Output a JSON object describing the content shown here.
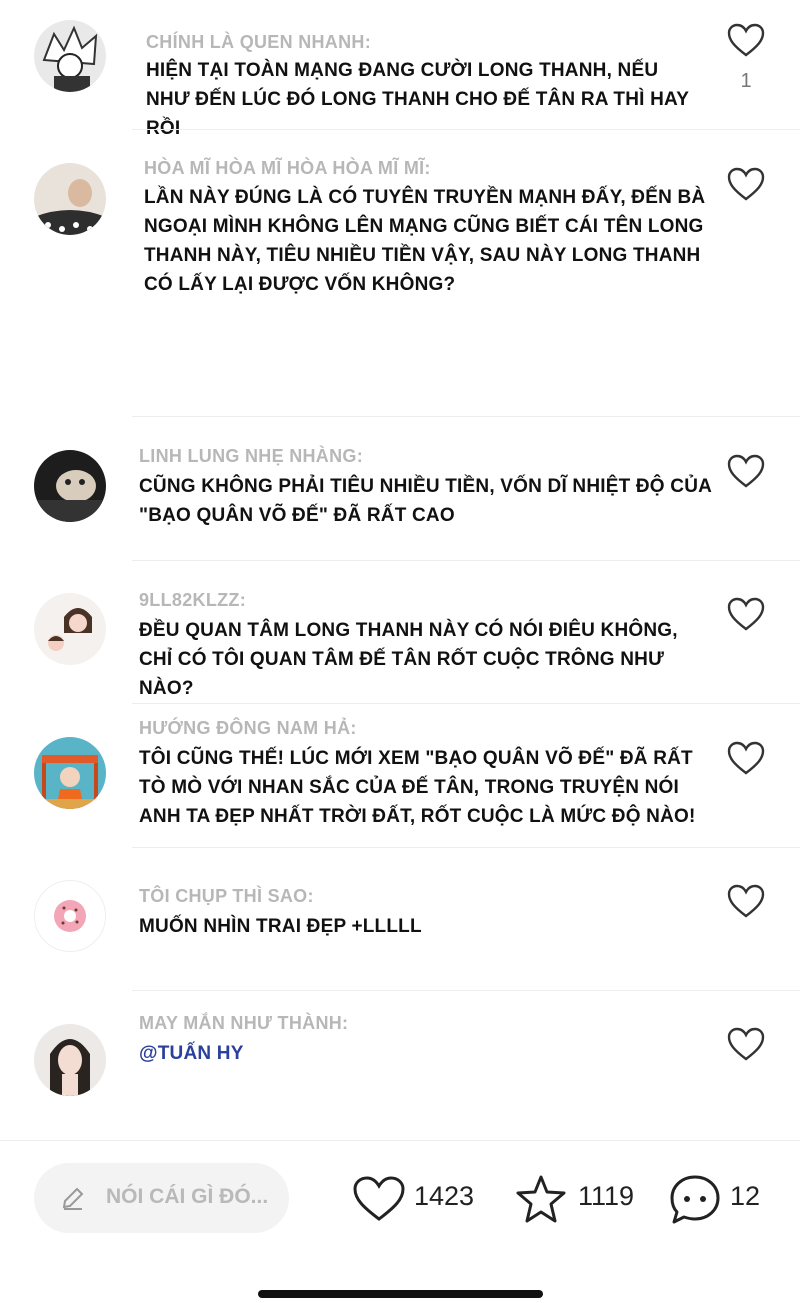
{
  "comments": [
    {
      "user": "Chính là quen nhanh:",
      "text": "Hiện tại toàn mạng đang cười Long Thanh, nếu như đến lúc đó Long Thanh cho Đế Tân ra thì hay rồi",
      "likes": "1"
    },
    {
      "user": "Hòa Mĩ Hòa Mĩ Hòa Hòa Mĩ Mĩ:",
      "text": "Lần này đúng là có tuyên truyền mạnh đấy, đến bà ngoại mình không lên mạng cũng biết cái tên Long Thanh này, tiêu nhiều tiền vậy, sau này Long Thanh có lấy lại được vốn không?",
      "likes": ""
    },
    {
      "user": "Linh Lung Nhẹ Nhàng:",
      "text": "Cũng không phải tiêu nhiều tiền, vốn dĩ nhiệt độ của \"Bạo Quân Võ Đế\" đã rất cao",
      "likes": ""
    },
    {
      "user": "9ll82klzz:",
      "text": "Đều quan tâm Long Thanh này có nói điêu không, chỉ có tôi quan tâm Đế Tân rốt cuộc trông như nào?",
      "likes": ""
    },
    {
      "user": "Hướng Đông Nam Hả:",
      "text": "Tôi cũng thế! Lúc mới xem \"Bạo Quân Võ Đế\" đã rất tò mò với nhan sắc của Đế Tân, trong truyện nói anh ta đẹp nhất trời đất, rốt cuộc là mức độ nào!",
      "likes": ""
    },
    {
      "user": "Tôi chụp thì sao:",
      "text": "Muốn nhìn trai đẹp +lllll",
      "likes": ""
    },
    {
      "user": "May mắn như thành:",
      "text": "",
      "mention": "@Tuấn Hy",
      "likes": ""
    }
  ],
  "bottom": {
    "placeholder": "Nói cái gì đó...",
    "like_count": "1423",
    "star_count": "1119",
    "comment_count": "12"
  },
  "icons": [
    "heart-icon",
    "pencil-icon",
    "star-icon",
    "chat-bubble-icon"
  ],
  "colors": {
    "username": "#b7b7b7",
    "text": "#111111",
    "mention": "#2b3f9c",
    "divider": "#eeeeee",
    "input_bg": "#f3f3f3"
  }
}
